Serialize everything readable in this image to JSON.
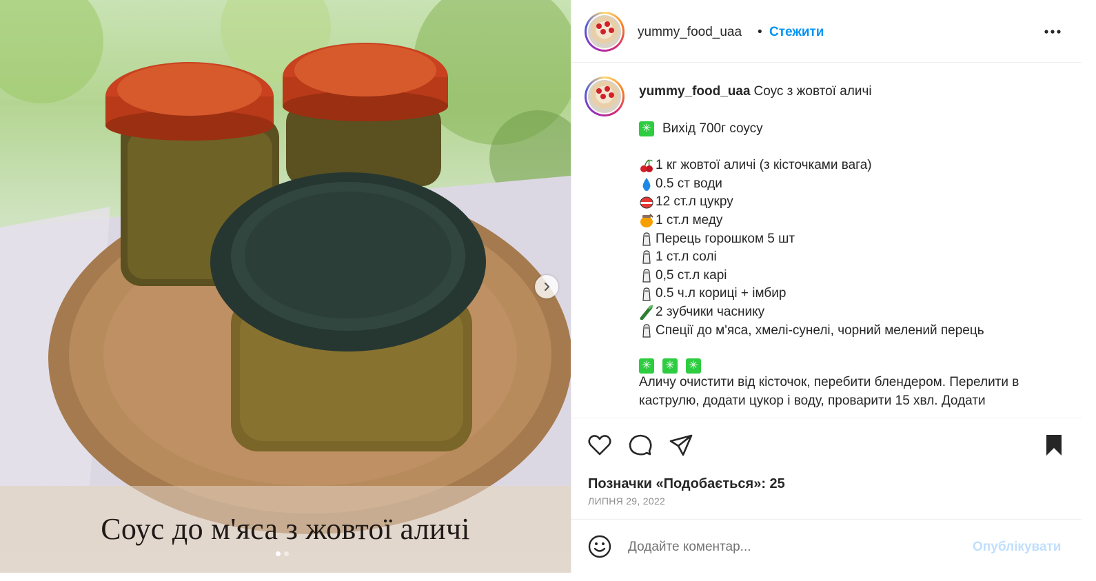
{
  "media": {
    "image_text": "Соус до м'яса з жовтої аличі",
    "next_icon": "chevron-right-icon",
    "slide_count": 2,
    "active_slide": 1
  },
  "header": {
    "username": "yummy_food_uaa",
    "separator": "•",
    "follow_label": "Стежити",
    "more_icon": "more-horizontal-icon"
  },
  "caption": {
    "username": "yummy_food_uaa",
    "title": "Соус з жовтої аличі",
    "yield_line": "Вихід 700г соусу",
    "ingredients": [
      {
        "icon": "cherries",
        "text": "1 кг жовтої аличі (з кісточками вага)"
      },
      {
        "icon": "droplet",
        "text": "0.5 ст води"
      },
      {
        "icon": "bowl",
        "text": "12 ст.л цукру"
      },
      {
        "icon": "honey-pot",
        "text": "1 ст.л меду"
      },
      {
        "icon": "salt-shaker",
        "text": "Перець горошком 5 шт"
      },
      {
        "icon": "salt-shaker",
        "text": "1 ст.л солі"
      },
      {
        "icon": "salt-shaker",
        "text": "0,5 ст.л карі"
      },
      {
        "icon": "salt-shaker",
        "text": "0.5 ч.л кориці + імбир"
      },
      {
        "icon": "garlic-greens",
        "text": "2 зубчики часнику"
      },
      {
        "icon": "salt-shaker",
        "text": "Спеції до м'яса, хмелі-сунелі, чорний мелений перець"
      }
    ],
    "method": "Аличу очистити від кісточок, перебити блендером. Перелити в каструлю, додати цукор і воду, проварити 15 хвл. Додати"
  },
  "actions": {
    "like_icon": "heart-icon",
    "comment_icon": "comment-icon",
    "share_icon": "share-icon",
    "save_icon": "bookmark-filled-icon",
    "likes_text": "Позначки «Подобається»: 25",
    "date": "ЛИПНЯ 29, 2022"
  },
  "comment": {
    "emoji_icon": "smiley-icon",
    "placeholder": "Додайте коментар...",
    "publish_label": "Опублікувати"
  },
  "colors": {
    "link_blue": "#0095f6",
    "publish_disabled": "#c0dffd",
    "sparkle_green": "#2ecc40"
  }
}
